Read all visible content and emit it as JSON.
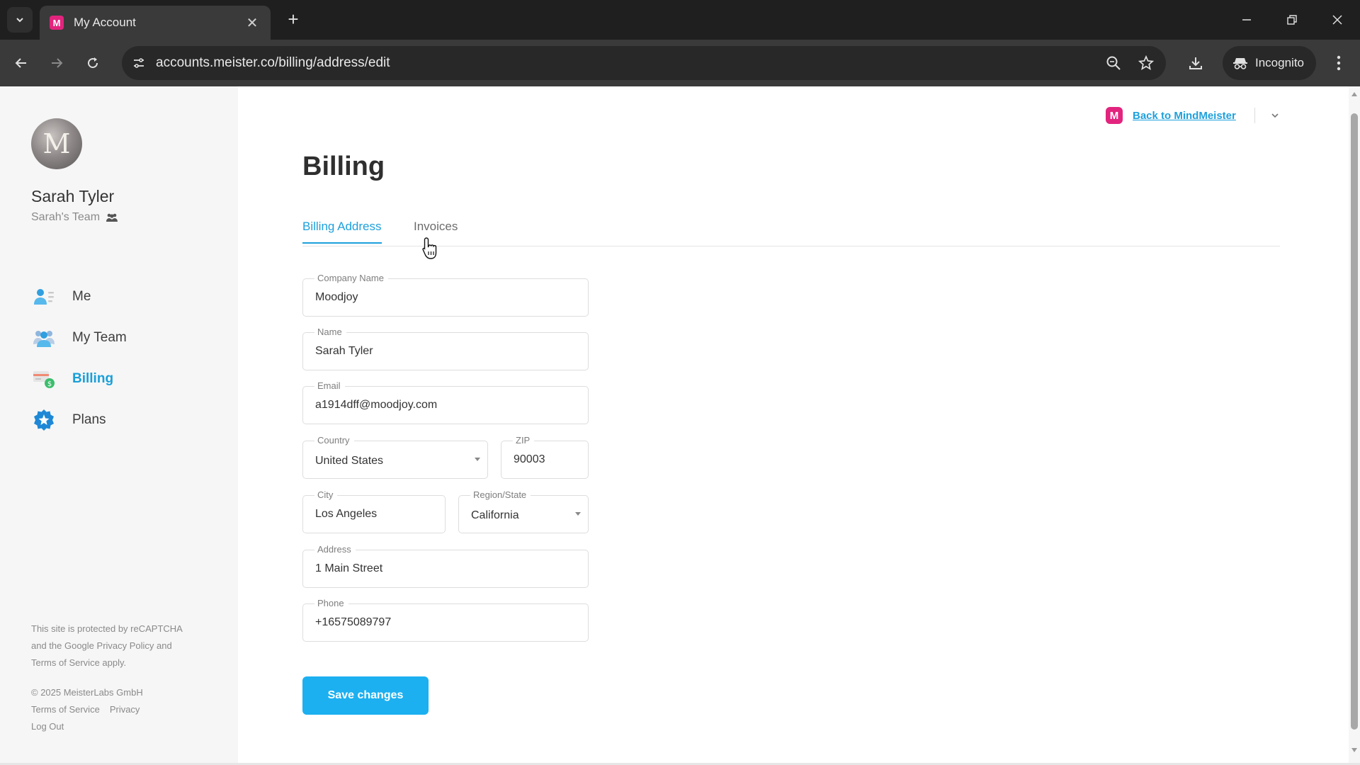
{
  "browser": {
    "tab_title": "My Account",
    "favicon_letter": "M",
    "url": "accounts.meister.co/billing/address/edit",
    "incognito_label": "Incognito"
  },
  "sidebar": {
    "user_name": "Sarah Tyler",
    "team_name": "Sarah's Team",
    "avatar_letter": "M",
    "nav": [
      {
        "label": "Me",
        "icon": "person-card-icon",
        "active": false
      },
      {
        "label": "My Team",
        "icon": "team-icon",
        "active": false
      },
      {
        "label": "Billing",
        "icon": "billing-icon",
        "active": true
      },
      {
        "label": "Plans",
        "icon": "plans-badge-icon",
        "active": false
      }
    ],
    "recaptcha_line1": "This site is protected by reCAPTCHA",
    "recaptcha_line2": "and the Google Privacy Policy and",
    "recaptcha_line3": "Terms of Service apply.",
    "copyright": "© 2025 MeisterLabs GmbH",
    "footer_terms": "Terms of Service",
    "footer_privacy": "Privacy",
    "logout": "Log Out"
  },
  "header": {
    "logo_letter": "M",
    "back_link": "Back to MindMeister"
  },
  "main": {
    "title": "Billing",
    "tabs": [
      {
        "label": "Billing Address",
        "active": true
      },
      {
        "label": "Invoices",
        "active": false
      }
    ],
    "form": {
      "company": {
        "label": "Company Name",
        "value": "Moodjoy"
      },
      "name": {
        "label": "Name",
        "value": "Sarah Tyler"
      },
      "email": {
        "label": "Email",
        "value": "a1914dff@moodjoy.com"
      },
      "country": {
        "label": "Country",
        "value": "United States"
      },
      "zip": {
        "label": "ZIP",
        "value": "90003"
      },
      "city": {
        "label": "City",
        "value": "Los Angeles"
      },
      "region": {
        "label": "Region/State",
        "value": "California"
      },
      "address": {
        "label": "Address",
        "value": "1 Main Street"
      },
      "phone": {
        "label": "Phone",
        "value": "+16575089797"
      }
    },
    "save_label": "Save changes"
  },
  "colors": {
    "accent": "#1ea0dc",
    "button": "#1cb0f0",
    "brand": "#e2247e"
  }
}
